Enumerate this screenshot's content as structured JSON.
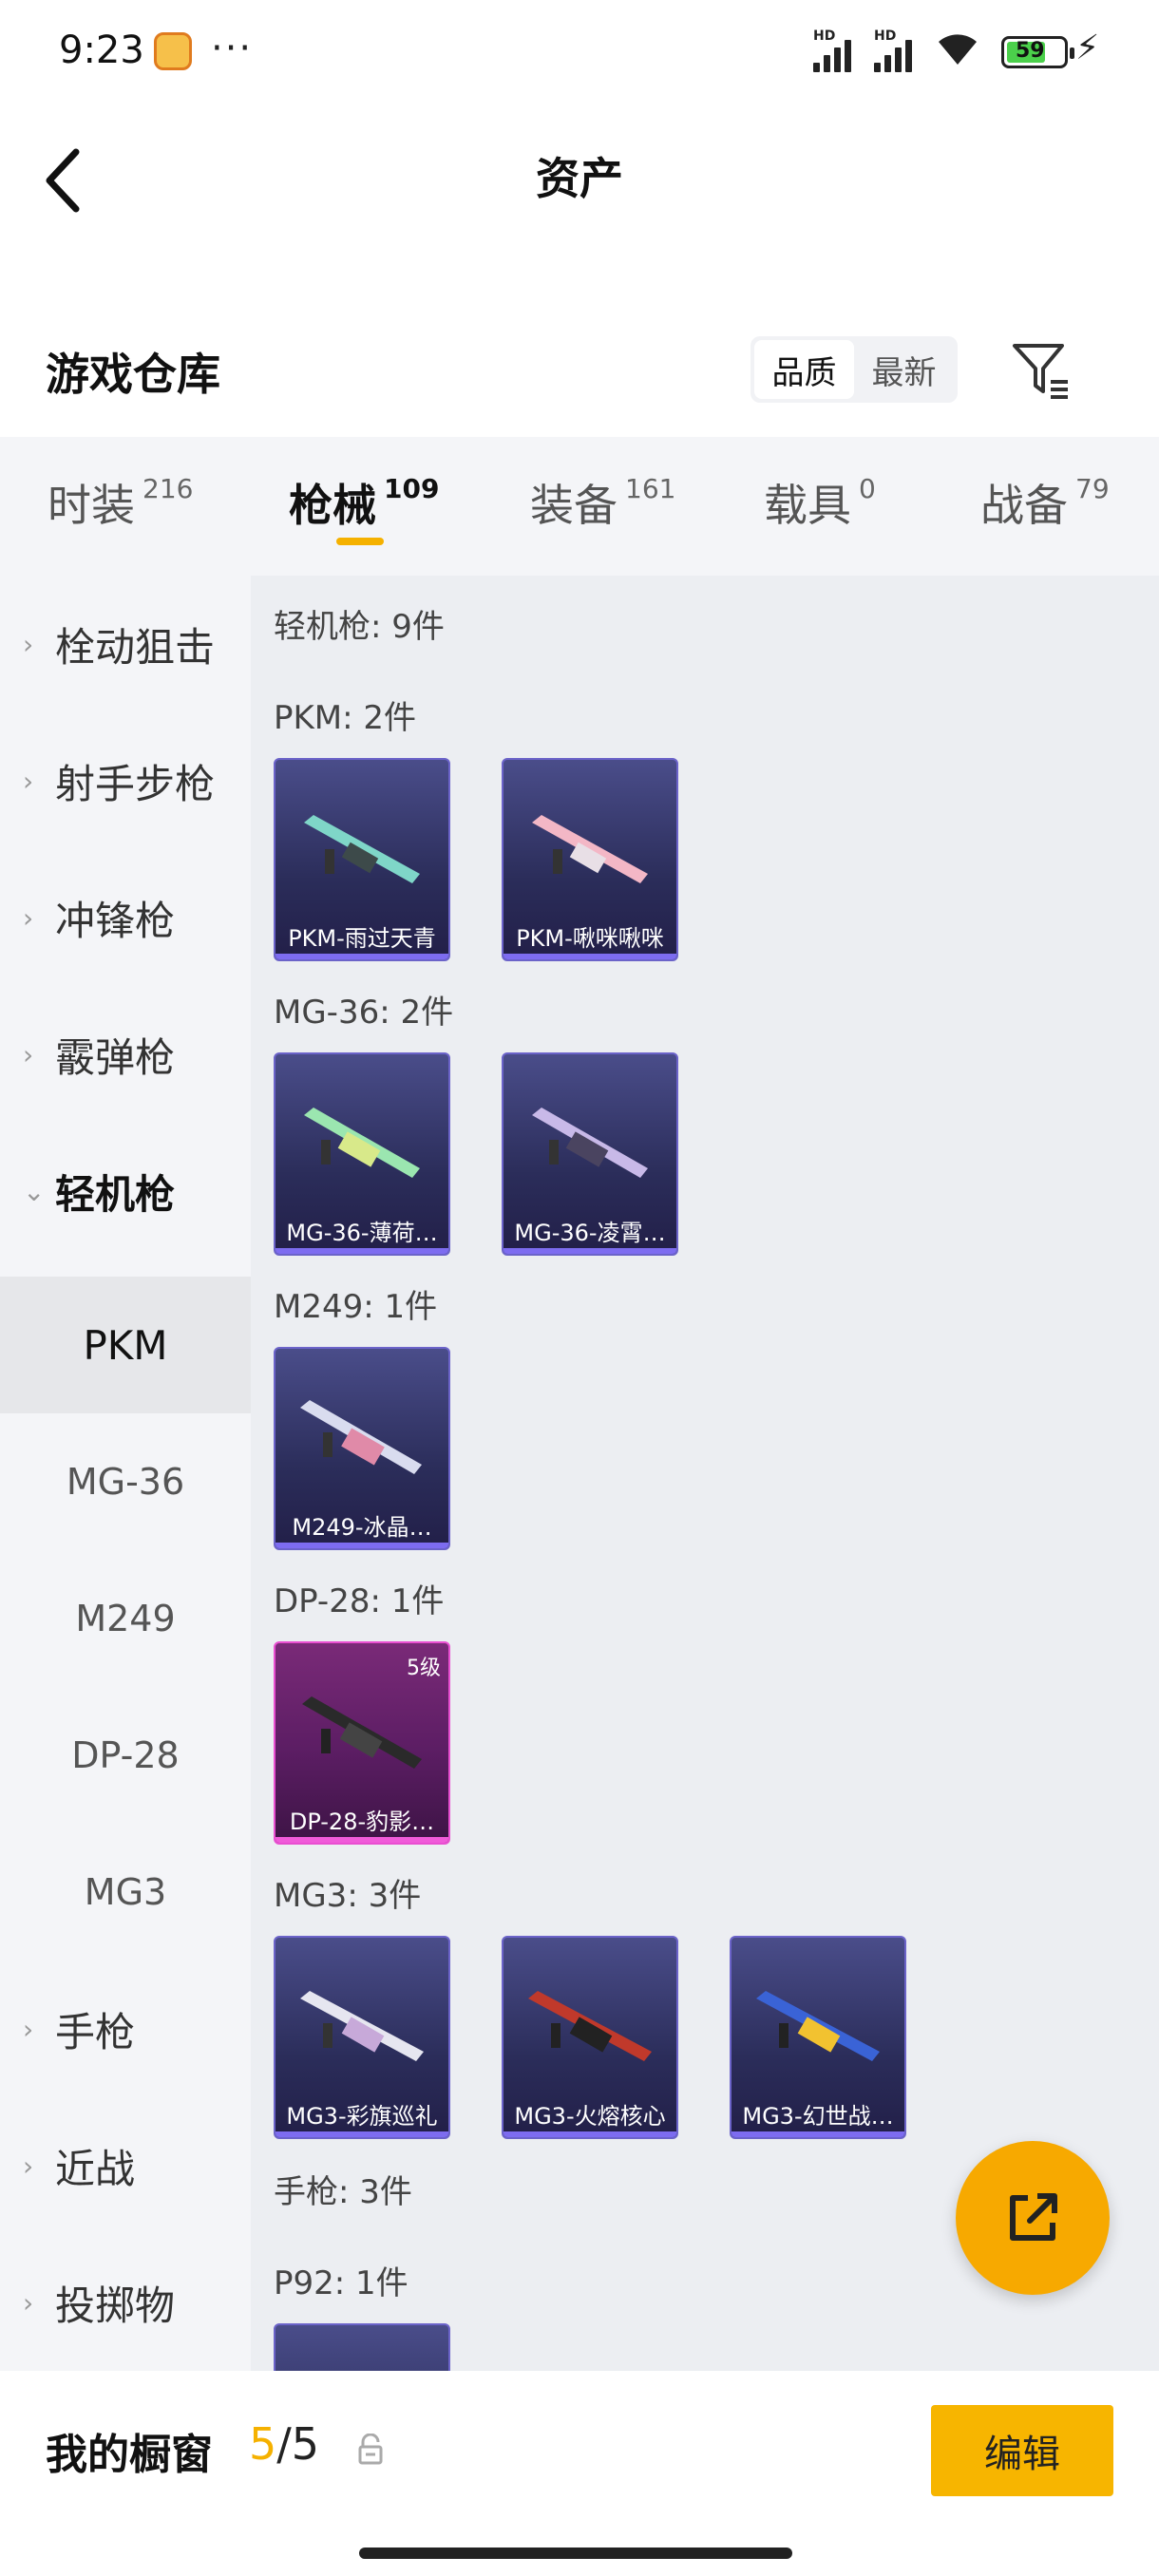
{
  "status_bar": {
    "time": "9:23",
    "more": "···",
    "signal1_label": "HD",
    "signal2_label": "HD",
    "battery_level": "59"
  },
  "header": {
    "title": "资产"
  },
  "warehouse": {
    "title": "游戏仓库",
    "sort_options": [
      "品质",
      "最新"
    ],
    "sort_active": "品质"
  },
  "category_tabs": [
    {
      "label": "时装",
      "count": "216"
    },
    {
      "label": "枪械",
      "count": "109",
      "active": true
    },
    {
      "label": "装备",
      "count": "161"
    },
    {
      "label": "载具",
      "count": "0"
    },
    {
      "label": "战备",
      "count": "79"
    }
  ],
  "sidebar": {
    "items": [
      {
        "label": "栓动狙击"
      },
      {
        "label": "射手步枪"
      },
      {
        "label": "冲锋枪"
      },
      {
        "label": "霰弹枪"
      },
      {
        "label": "轻机枪",
        "expanded": true
      }
    ],
    "sub_items": [
      {
        "label": "PKM",
        "active": true
      },
      {
        "label": "MG-36"
      },
      {
        "label": "M249"
      },
      {
        "label": "DP-28"
      },
      {
        "label": "MG3"
      }
    ],
    "more_items": [
      {
        "label": "手枪"
      },
      {
        "label": "近战"
      },
      {
        "label": "投掷物"
      }
    ]
  },
  "content": {
    "group_header": "轻机枪: 9件",
    "sections": [
      {
        "label": "PKM: 2件",
        "cards": [
          {
            "name": "PKM-雨过天青",
            "accent": "#7fd6c8"
          },
          {
            "name": "PKM-啾咪啾咪",
            "accent": "#f3b7c6"
          }
        ]
      },
      {
        "label": "MG-36: 2件",
        "cards": [
          {
            "name": "MG-36-薄荷…",
            "accent": "#9be6b0"
          },
          {
            "name": "MG-36-凌霄…",
            "accent": "#c8b9e8"
          }
        ]
      },
      {
        "label": "M249: 1件",
        "cards": [
          {
            "name": "M249-冰晶…",
            "accent": "#d9dcef"
          }
        ]
      },
      {
        "label": "DP-28: 1件",
        "cards": [
          {
            "name": "DP-28-豹影…",
            "accent": "#333333",
            "level": "5级",
            "quality": "pink"
          }
        ]
      },
      {
        "label": "MG3: 3件",
        "cards": [
          {
            "name": "MG3-彩旗巡礼",
            "accent": "#e6e6f0"
          },
          {
            "name": "MG3-火熔核心",
            "accent": "#c0392b"
          },
          {
            "name": "MG3-幻世战…",
            "accent": "#3a63d6"
          }
        ]
      }
    ],
    "next_group_header": "手枪: 3件",
    "next_section_label": "P92: 1件"
  },
  "bottom": {
    "window_label": "我的橱窗",
    "window_current": "5",
    "window_total": "/5",
    "edit_label": "编辑"
  },
  "colors": {
    "accent": "#f7b500",
    "card_purple": "#2b2d5a",
    "card_pink": "#5b1d63"
  }
}
